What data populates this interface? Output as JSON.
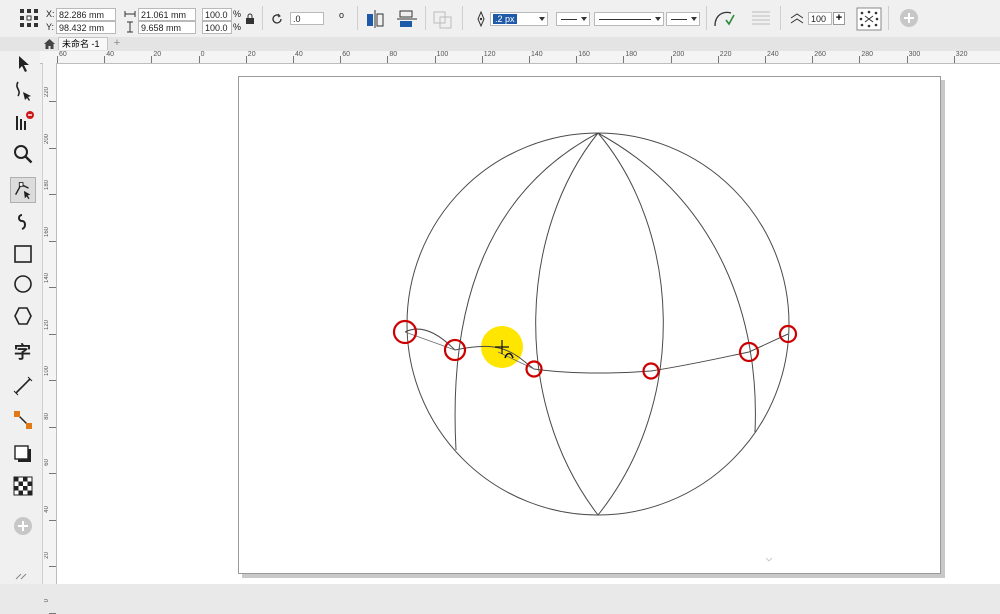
{
  "propbar": {
    "x_label": "X:",
    "x_value": "82.286 mm",
    "y_label": "Y:",
    "y_value": "98.432 mm",
    "width_value": "21.061 mm",
    "height_value": "9.658 mm",
    "scale_x": "100.0",
    "scale_y": "100.0",
    "percent": "%",
    "rotation": ".0",
    "degree": "o",
    "outline_width": ".2 px",
    "smoothing_value": "100"
  },
  "document_tab": {
    "label": "未命名 -1",
    "add": "+"
  },
  "hruler_labels": [
    "60",
    "40",
    "20",
    "0",
    "20",
    "40",
    "60",
    "80",
    "100",
    "120",
    "140",
    "160",
    "180",
    "200",
    "220",
    "240",
    "260",
    "280",
    "300",
    "320"
  ],
  "vruler_labels": [
    "220",
    "200",
    "180",
    "160",
    "140",
    "120",
    "100",
    "80",
    "60",
    "40",
    "20",
    "0"
  ],
  "icons": {
    "object_origin": "object-origin-icon",
    "lock_ratio": "lock-icon",
    "rotate": "rotate-icon",
    "pick": "pick-tool-icon",
    "shape": "shape-tool-icon",
    "crop": "crop-tool-icon",
    "zoom": "zoom-tool-icon",
    "freehand": "freehand-tool-icon",
    "artistic": "artistic-media-icon",
    "rectangle": "rectangle-tool-icon",
    "ellipse": "ellipse-tool-icon",
    "polygon": "polygon-tool-icon",
    "text": "text-tool-icon",
    "parallel": "parallel-dimension-icon",
    "connector": "connector-tool-icon",
    "shadow": "drop-shadow-icon",
    "transparency": "transparency-icon",
    "add_tool": "add-tool-icon"
  },
  "colors": {
    "highlight": "#ffe600",
    "node_circle": "#cc0000",
    "stroke": "#4a4a4a",
    "accent_blue": "#1e5aa8"
  }
}
